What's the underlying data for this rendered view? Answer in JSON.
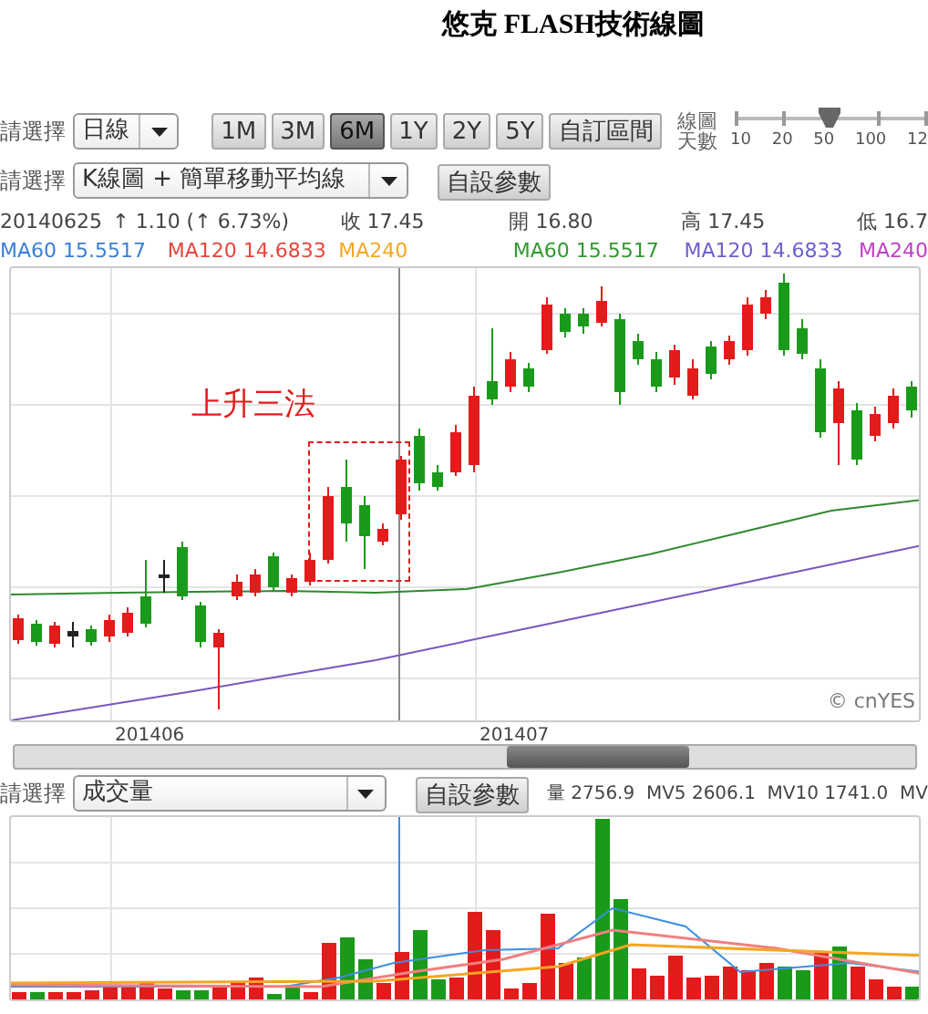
{
  "title": "悠克 FLASH技術線圖",
  "row1": {
    "label": "請選擇",
    "select": "日線",
    "periods": [
      {
        "label": "1M",
        "selected": false
      },
      {
        "label": "3M",
        "selected": false
      },
      {
        "label": "6M",
        "selected": true
      },
      {
        "label": "1Y",
        "selected": false
      },
      {
        "label": "2Y",
        "selected": false
      },
      {
        "label": "5Y",
        "selected": false
      }
    ],
    "custom_range": "自訂區間",
    "slider": {
      "label": "線圖天數",
      "ticks": [
        "10",
        "20",
        "50",
        "100",
        "12"
      ],
      "level": 0.5
    }
  },
  "row2": {
    "label": "請選擇",
    "select": "K線圖 + 簡單移動平均線",
    "button": "自設參數"
  },
  "quote": [
    "20140625",
    "↑ 1.10 (↑ 6.73%)",
    "收 17.45",
    "開 16.80",
    "高 17.45",
    "低 16.7"
  ],
  "ma_legend": [
    {
      "text": "MA60 15.5517",
      "color": "#3a7fd5"
    },
    {
      "text": "MA120 14.6833",
      "color": "#e8453c"
    },
    {
      "text": "MA240",
      "color": "#f5a623"
    },
    {
      "text": "MA60 15.5517",
      "color": "#2f9a2f"
    },
    {
      "text": "MA120 14.6833",
      "color": "#6b5fd0"
    },
    {
      "text": "MA240",
      "color": "#c040c0"
    }
  ],
  "chart": {
    "annotation": "上升三法",
    "credit": "© cnYES",
    "x_labels": [
      "201406",
      "201407"
    ]
  },
  "volume_row": {
    "label": "請選擇",
    "select": "成交量",
    "button": "自設參數",
    "stats": "量 2756.9  MV5 2606.1  MV10 1741.0  MV"
  }
}
